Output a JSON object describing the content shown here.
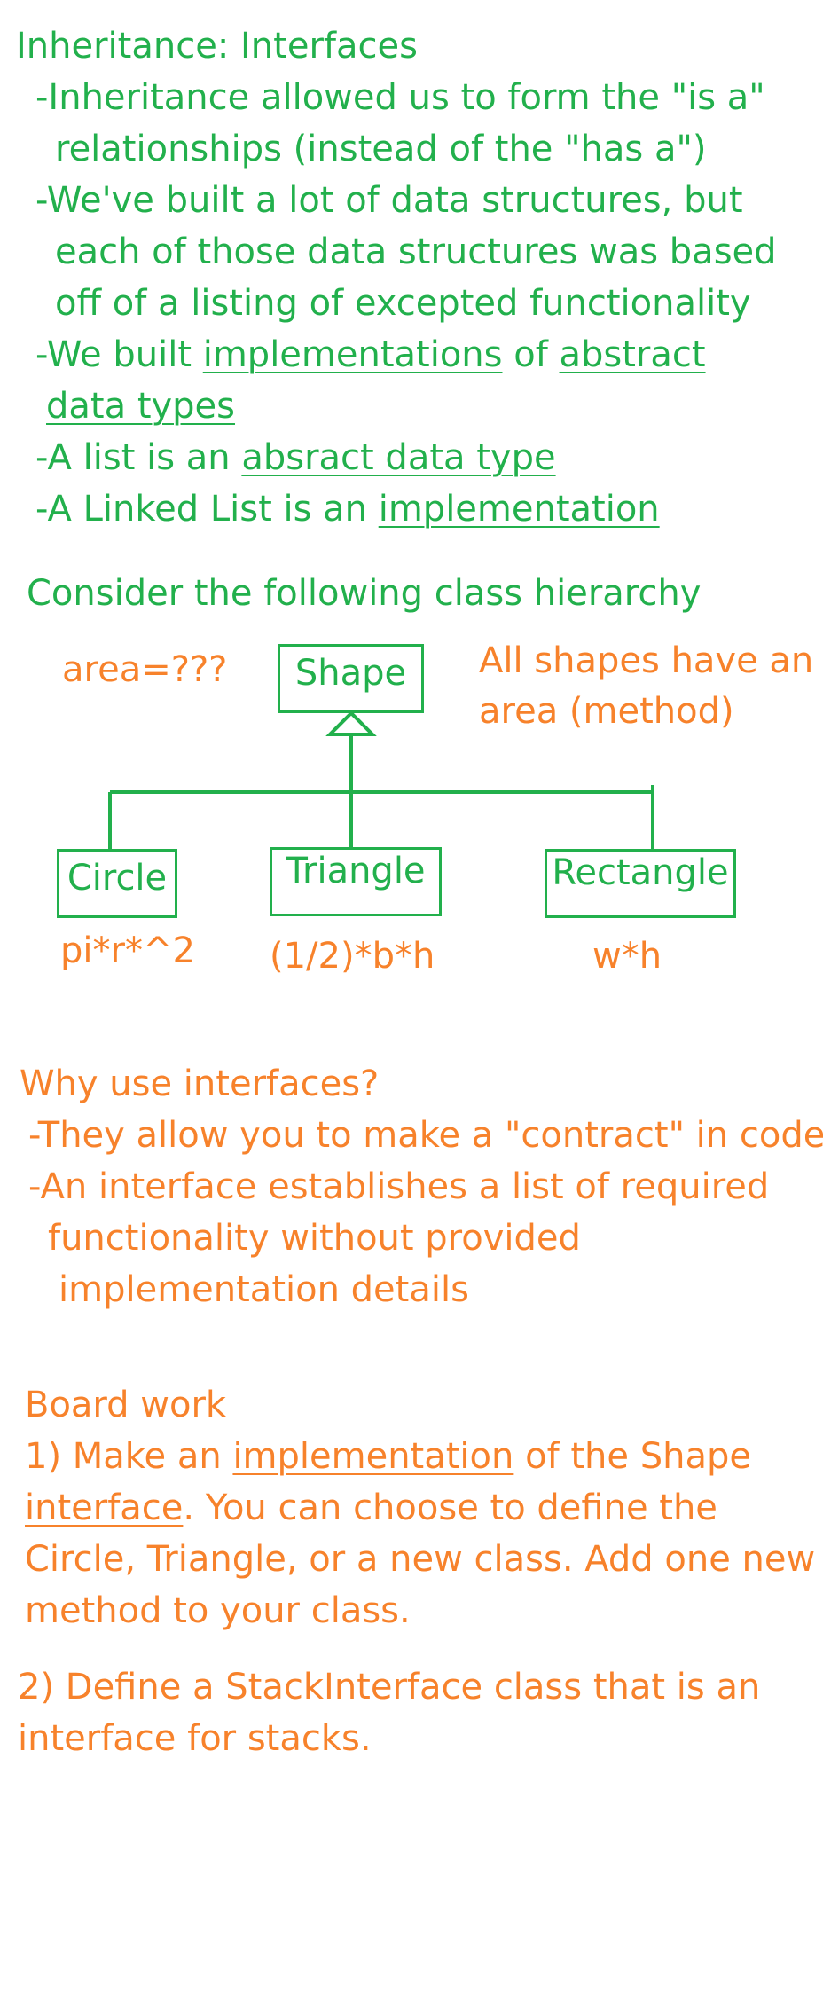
{
  "inheritance": {
    "title": "Inheritance: Interfaces",
    "line1": "-Inheritance allowed us to form the \"is a\"",
    "line2": "relationships (instead of the \"has a\")",
    "line3": "-We've built a lot of data structures, but",
    "line4": "each of those data structures was based",
    "line5": "off of a listing of excepted functionality",
    "line6_pre": "-We built ",
    "line6_u1": "implementations",
    "line6_mid": " of ",
    "line6_u2": "abstract",
    "line7_u": "data types",
    "line8_pre": "-A list is an ",
    "line8_u": "absract data type",
    "line9_pre": "-A Linked List is an ",
    "line9_u": "implementation"
  },
  "hierarchy": {
    "intro": "Consider the following class hierarchy",
    "shape_label": "Shape",
    "shape_area": "area=???",
    "note_line1": "All shapes have an",
    "note_line2": "area (method)",
    "children": [
      {
        "label": "Circle",
        "formula": "pi*r*^2"
      },
      {
        "label": "Triangle",
        "formula": "(1/2)*b*h"
      },
      {
        "label": "Rectangle",
        "formula": "w*h"
      }
    ],
    "colors": {
      "structure": "#22b04c",
      "annotation": "#f7822b"
    }
  },
  "why": {
    "title": "Why use interfaces?",
    "line1": "-They allow you to make a \"contract\" in code",
    "line2": "-An interface establishes a list of required",
    "line3": "functionality without provided",
    "line4": "implementation details"
  },
  "board": {
    "title": "Board work",
    "item1_line1_pre": "1) Make an ",
    "item1_line1_u": "implementation",
    "item1_line1_post": " of the Shape",
    "item1_line2_u": "interface",
    "item1_line2_post": ". You can choose to define the",
    "item1_line3": "Circle, Triangle, or a new class. Add one new",
    "item1_line4": "method to your class.",
    "item2_line1": "2) Define a StackInterface class that is an",
    "item2_line2": "interface for stacks."
  }
}
